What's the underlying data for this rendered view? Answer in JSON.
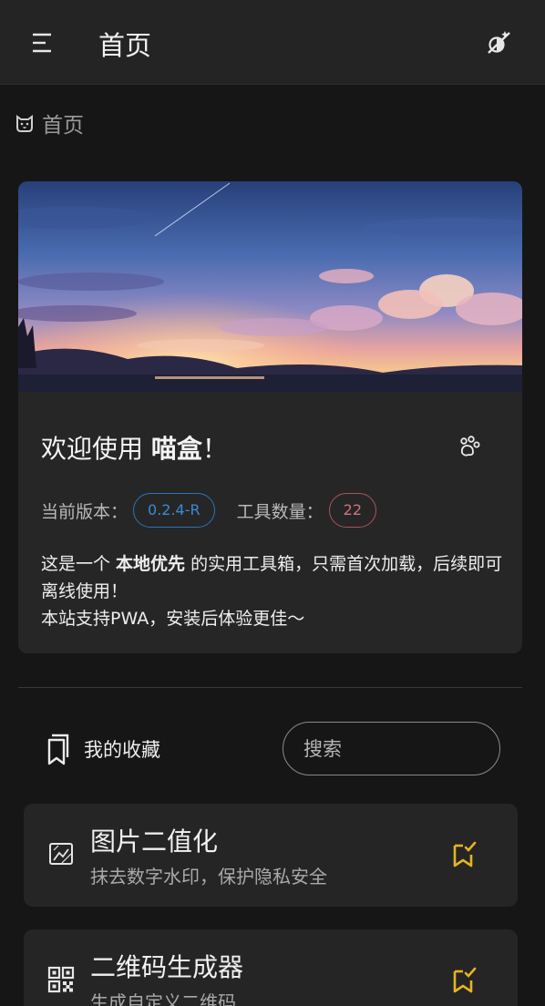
{
  "header": {
    "title": "首页",
    "menu_icon": "menu-icon",
    "theme_icon": "theme-toggle-icon"
  },
  "breadcrumb": {
    "icon": "cat-icon",
    "label": "首页"
  },
  "welcome_card": {
    "banner": "sky-sunset-illustration",
    "greeting_prefix": "欢迎使用 ",
    "app_name": "喵盒",
    "greeting_suffix": "！",
    "paw_icon": "paw-icon",
    "version_label": "当前版本：",
    "version_value": "0.2.4-R",
    "tool_count_label": "工具数量：",
    "tool_count_value": "22",
    "desc_prefix": "这是一个 ",
    "desc_bold": "本地优先",
    "desc_suffix": " 的实用工具箱，只需首次加载，后续即可离线使用！",
    "desc_line2": "本站支持PWA，安装后体验更佳～"
  },
  "favorites": {
    "title": "我的收藏",
    "icon": "bookmark-icon",
    "search_placeholder": "搜索"
  },
  "tools": [
    {
      "name": "图片二值化",
      "desc": "抹去数字水印，保护隐私安全",
      "icon": "image-icon",
      "star_icon": "bookmark-check-icon"
    },
    {
      "name": "二维码生成器",
      "desc": "生成自定义二维码",
      "icon": "qrcode-icon",
      "star_icon": "bookmark-check-icon"
    }
  ],
  "colors": {
    "background": "#161616",
    "topbar": "#242424",
    "card": "#262626",
    "accent_blue": "#3b8ad6",
    "accent_red": "#d0737c",
    "bookmark_gold": "#e6b422"
  }
}
